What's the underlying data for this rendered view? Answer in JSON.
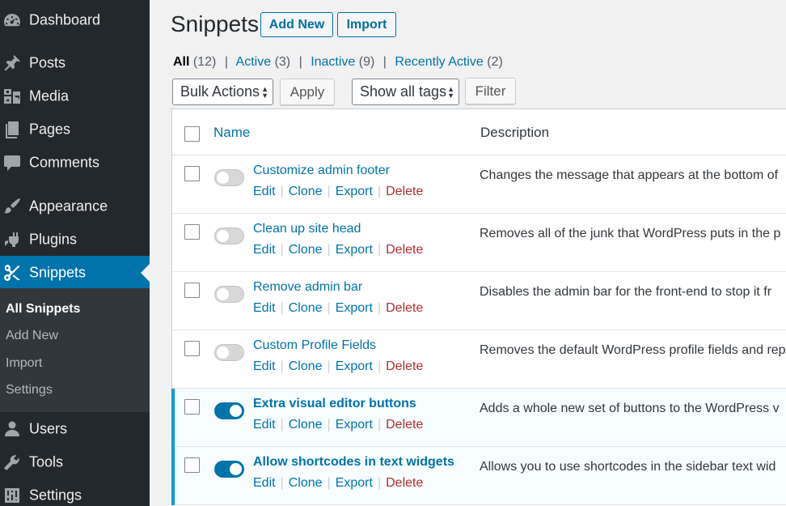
{
  "sidebar": {
    "items": [
      {
        "key": "dashboard",
        "label": "Dashboard",
        "icon": "dashboard-icon"
      },
      {
        "key": "posts",
        "label": "Posts",
        "icon": "pushpin-icon"
      },
      {
        "key": "media",
        "label": "Media",
        "icon": "media-icon"
      },
      {
        "key": "pages",
        "label": "Pages",
        "icon": "pages-icon"
      },
      {
        "key": "comments",
        "label": "Comments",
        "icon": "comment-icon"
      },
      {
        "key": "appearance",
        "label": "Appearance",
        "icon": "paintbrush-icon"
      },
      {
        "key": "plugins",
        "label": "Plugins",
        "icon": "plugin-icon"
      },
      {
        "key": "snippets",
        "label": "Snippets",
        "icon": "scissors-icon"
      },
      {
        "key": "users",
        "label": "Users",
        "icon": "user-icon"
      },
      {
        "key": "tools",
        "label": "Tools",
        "icon": "wrench-icon"
      },
      {
        "key": "settings",
        "label": "Settings",
        "icon": "sliders-icon"
      }
    ],
    "submenu": [
      "All Snippets",
      "Add New",
      "Import",
      "Settings"
    ]
  },
  "header": {
    "title": "Snippets",
    "add_new_label": "Add New",
    "import_label": "Import"
  },
  "filters": {
    "all": {
      "label": "All",
      "count": "(12)"
    },
    "active": {
      "label": "Active",
      "count": "(3)"
    },
    "inactive": {
      "label": "Inactive",
      "count": "(9)"
    },
    "recently_active": {
      "label": "Recently Active",
      "count": "(2)"
    },
    "separator": "|"
  },
  "toolbar": {
    "bulk_actions": "Bulk Actions",
    "apply": "Apply",
    "tags": "Show all tags",
    "filter": "Filter"
  },
  "table": {
    "columns": {
      "name": "Name",
      "description": "Description"
    },
    "row_actions": {
      "edit": "Edit",
      "clone": "Clone",
      "export": "Export",
      "delete": "Delete",
      "separator": "|"
    },
    "rows": [
      {
        "name": "Customize admin footer",
        "description": "Changes the message that appears at the bottom of",
        "active": false
      },
      {
        "name": "Clean up site head",
        "description": "Removes all of the junk that WordPress puts in the p",
        "active": false
      },
      {
        "name": "Remove admin bar",
        "description": "Disables the admin bar for the front-end to stop it fr",
        "active": false
      },
      {
        "name": "Custom Profile Fields",
        "description": "Removes the default WordPress profile fields and rep",
        "active": false
      },
      {
        "name": "Extra visual editor buttons",
        "description": "Adds a whole new set of buttons to the WordPress v",
        "active": true
      },
      {
        "name": "Allow shortcodes in text widgets",
        "description": "Allows you to use shortcodes in the sidebar text wid",
        "active": true
      }
    ]
  },
  "colors": {
    "sidebar_bg": "#23282d",
    "submenu_bg": "#32373c",
    "accent": "#0073aa",
    "delete": "#b32d2e",
    "active_row_bar": "#00a0d2"
  }
}
